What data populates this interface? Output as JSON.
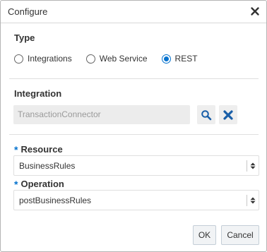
{
  "dialog": {
    "title": "Configure",
    "close_icon": "close-icon"
  },
  "type_section": {
    "label": "Type",
    "options": [
      {
        "label": "Integrations",
        "checked": false
      },
      {
        "label": "Web Service",
        "checked": false
      },
      {
        "label": "REST",
        "checked": true
      }
    ]
  },
  "integration_section": {
    "label": "Integration",
    "value": "TransactionConnector",
    "search_icon": "search-icon",
    "clear_icon": "clear-icon"
  },
  "resource": {
    "required_mark": "*",
    "label": "Resource",
    "value": "BusinessRules"
  },
  "operation": {
    "required_mark": "*",
    "label": "Operation",
    "value": "postBusinessRules"
  },
  "buttons": {
    "ok_label": "OK",
    "cancel_label": "Cancel"
  },
  "colors": {
    "accent": "#0572ce",
    "icon_blue": "#1a5fa8"
  }
}
